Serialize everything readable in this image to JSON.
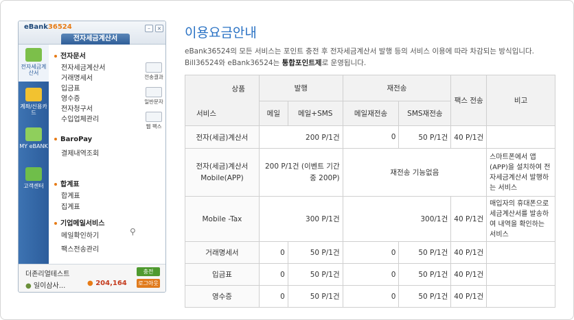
{
  "widget": {
    "logo_prefix": "eBank",
    "logo_number": "36524",
    "tab_title": "전자세금계산서",
    "sidebar": [
      {
        "label": "전자세금계산서",
        "icon": "monitor-icon"
      },
      {
        "label": "계좌/신용카드",
        "icon": "card-icon"
      },
      {
        "label": "MY eBANK",
        "icon": "folder-icon"
      },
      {
        "label": "고객센터",
        "icon": "chat-icon"
      }
    ],
    "sections": [
      {
        "title": "전자문서",
        "items": [
          "전자세금계산서",
          "거래명세서",
          "입금표",
          "영수증",
          "전자청구서",
          "수입업체관리"
        ]
      },
      {
        "title": "BaroPay",
        "items": [
          "결제내역조회"
        ]
      },
      {
        "title": "합계표",
        "items": [
          "합계표",
          "집계표"
        ]
      },
      {
        "title": "기업메일서비스",
        "items": [
          "메일확인하기",
          "팩스전송관리"
        ]
      }
    ],
    "mini_buttons": [
      "전송결과",
      "일반문자",
      "웹 팩스"
    ],
    "footer": {
      "user_name": "더존리얼테스트",
      "company": "일이삼사...",
      "points": "204,164",
      "charge_label": "충전",
      "logout_label": "로그아웃"
    }
  },
  "content": {
    "title": "이용요금안내",
    "desc_line1": "eBank36524의 모든 서비스는 포인트 충전 후 전자세금계산서 발행 등의 서비스 이용에 따라 차감되는 방식입니다.",
    "desc_line2_a": "Bill36524와 eBank36524는 ",
    "desc_line2_b": "통합포인트제",
    "desc_line2_c": "로 운영됩니다.",
    "table": {
      "h_product": "상품",
      "h_service": "서비스",
      "h_issue": "발행",
      "h_resend": "재전송",
      "h_fax": "팩스 전송",
      "h_note": "비고",
      "h_mail": "메일",
      "h_mail_sms": "메일+SMS",
      "h_mail_resend": "메일재전송",
      "h_sms_resend": "SMS재전송",
      "rows": [
        {
          "name": "전자(세금)계산서",
          "issue": "200 P/1건",
          "mail_resend": "0",
          "sms_resend": "50 P/1건",
          "fax": "40 P/1건",
          "note": ""
        },
        {
          "name": "전자(세금)계산서 Mobile(APP)",
          "issue": "200 P/1건 (이벤트 기간 중 200P)",
          "resend": "재전송 기능없음",
          "note": "스마트폰에서 앱(APP)을 설치하여 전자세금계산서 발행하는 서비스"
        },
        {
          "name": "Mobile -Tax",
          "issue": "300 P/1건",
          "resend": "300/1건",
          "fax": "40 P/1건",
          "note": "매입자의 휴대폰으로 세금계산서를 발송하여 내역을 확인하는 서비스"
        },
        {
          "name": "거래명세서",
          "mail": "0",
          "mail_sms": "50 P/1건",
          "mail_resend": "0",
          "sms_resend": "50 P/1건",
          "fax": "40 P/1건",
          "note": ""
        },
        {
          "name": "입금표",
          "mail": "0",
          "mail_sms": "50 P/1건",
          "mail_resend": "0",
          "sms_resend": "50 P/1건",
          "fax": "40 P/1건",
          "note": ""
        },
        {
          "name": "영수증",
          "mail": "0",
          "mail_sms": "50 P/1건",
          "mail_resend": "0",
          "sms_resend": "50 P/1건",
          "fax": "40 P/1건",
          "note": ""
        }
      ]
    }
  },
  "colors": {
    "accent": "#2a72c4",
    "brand_orange": "#e77b16",
    "sidebar_blue": "#2c5d9c",
    "points_red": "#c43a1c"
  }
}
